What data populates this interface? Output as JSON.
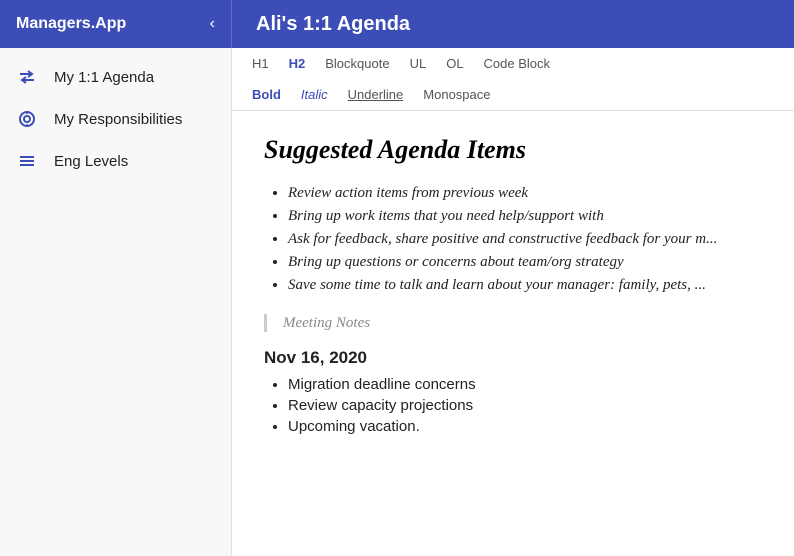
{
  "header": {
    "brand": "Managers.App",
    "chevron": "‹",
    "title": "Ali's 1:1 Agenda"
  },
  "sidebar": {
    "items": [
      {
        "id": "my-1-1-agenda",
        "label": "My 1:1 Agenda",
        "icon": "arrow-icon"
      },
      {
        "id": "my-responsibilities",
        "label": "My Responsibilities",
        "icon": "target-icon"
      },
      {
        "id": "eng-levels",
        "label": "Eng Levels",
        "icon": "lines-icon"
      }
    ]
  },
  "toolbar": {
    "row1": [
      {
        "id": "h1",
        "label": "H1",
        "active": false
      },
      {
        "id": "h2",
        "label": "H2",
        "active": true
      },
      {
        "id": "blockquote",
        "label": "Blockquote",
        "active": false
      },
      {
        "id": "ul",
        "label": "UL",
        "active": false
      },
      {
        "id": "ol",
        "label": "OL",
        "active": false
      },
      {
        "id": "code-block",
        "label": "Code Block",
        "active": false
      }
    ],
    "row2": [
      {
        "id": "bold",
        "label": "Bold",
        "style": "bold"
      },
      {
        "id": "italic",
        "label": "Italic",
        "style": "italic"
      },
      {
        "id": "underline",
        "label": "Underline",
        "style": "normal"
      },
      {
        "id": "monospace",
        "label": "Monospace",
        "style": "normal"
      }
    ]
  },
  "editor": {
    "title": "Suggested Agenda Items",
    "bullet_items": [
      "Review action items from previous week",
      "Bring up work items that you need help/support with",
      "Ask for feedback, share positive and constructive feedback for your m...",
      "Bring up questions or concerns about team/org strategy",
      "Save some time to talk and learn about your manager: family, pets, ..."
    ],
    "blockquote_text": "Meeting Notes",
    "date": "Nov 16, 2020",
    "notes": [
      "Migration deadline concerns",
      "Review capacity projections",
      "Upcoming vacation."
    ]
  }
}
